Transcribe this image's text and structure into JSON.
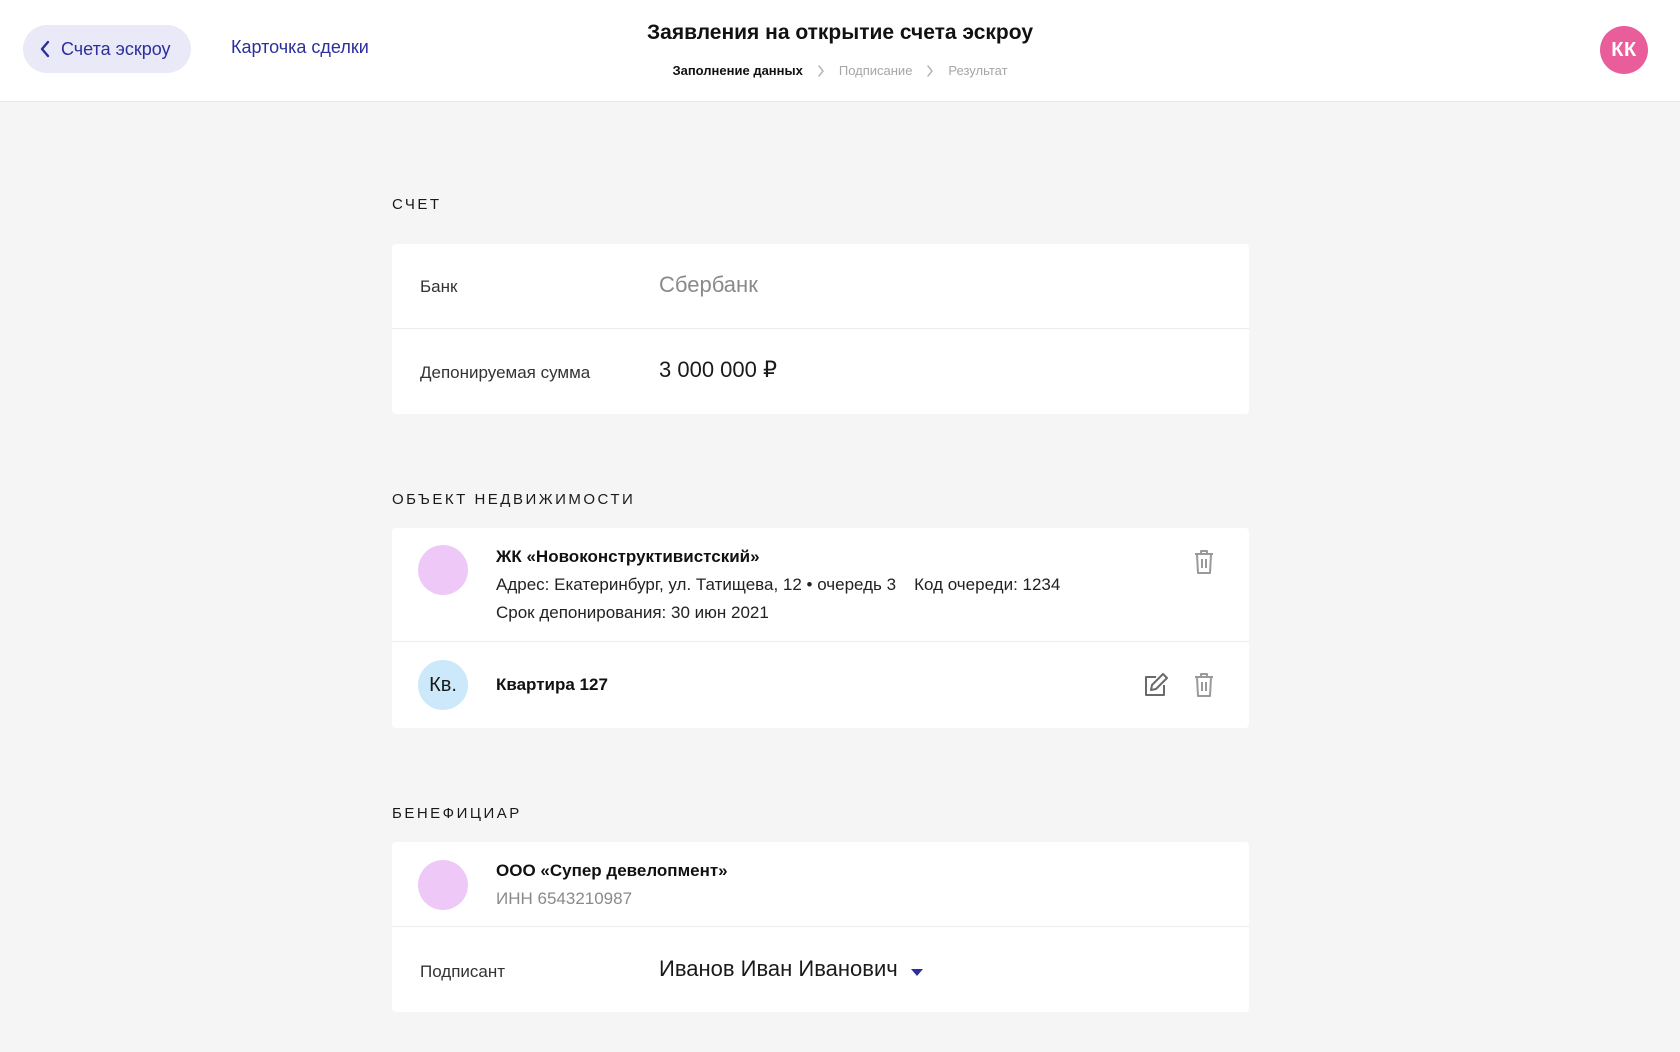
{
  "header": {
    "back_label": "Счета эскроу",
    "deal_link": "Карточка сделки",
    "title": "Заявления на открытие счета эскроу",
    "steps": [
      "Заполнение данных",
      "Подписание",
      "Результат"
    ],
    "avatar_initials": "КК"
  },
  "account": {
    "section_title": "СЧЕТ",
    "bank_label": "Банк",
    "bank_value": "Сбербанк",
    "amount_label": "Депонируемая сумма",
    "amount_value": "3 000 000 ₽"
  },
  "property": {
    "section_title": "ОБЪЕКТ НЕДВИЖИМОСТИ",
    "complex_name": "ЖК «Новоконструктивистский»",
    "address": "Адрес: Екатеринбург, ул. Татищева, 12 • очередь 3",
    "queue_code": "Код очереди: 1234",
    "deposit_term": "Срок депонирования: 30 июн 2021",
    "apartment_badge": "Кв.",
    "apartment_name": "Квартира 127"
  },
  "beneficiary": {
    "section_title": "БЕНЕФИЦИАР",
    "company_name": "ООО «Супер девелопмент»",
    "inn": "ИНН 6543210987",
    "signer_label": "Подписант",
    "signer_value": "Иванов Иван Иванович"
  },
  "colors": {
    "accent": "#2c2f9c",
    "avatar": "#e85d9a",
    "pink_circle": "#eec9f7",
    "blue_circle": "#cbe9fb"
  }
}
